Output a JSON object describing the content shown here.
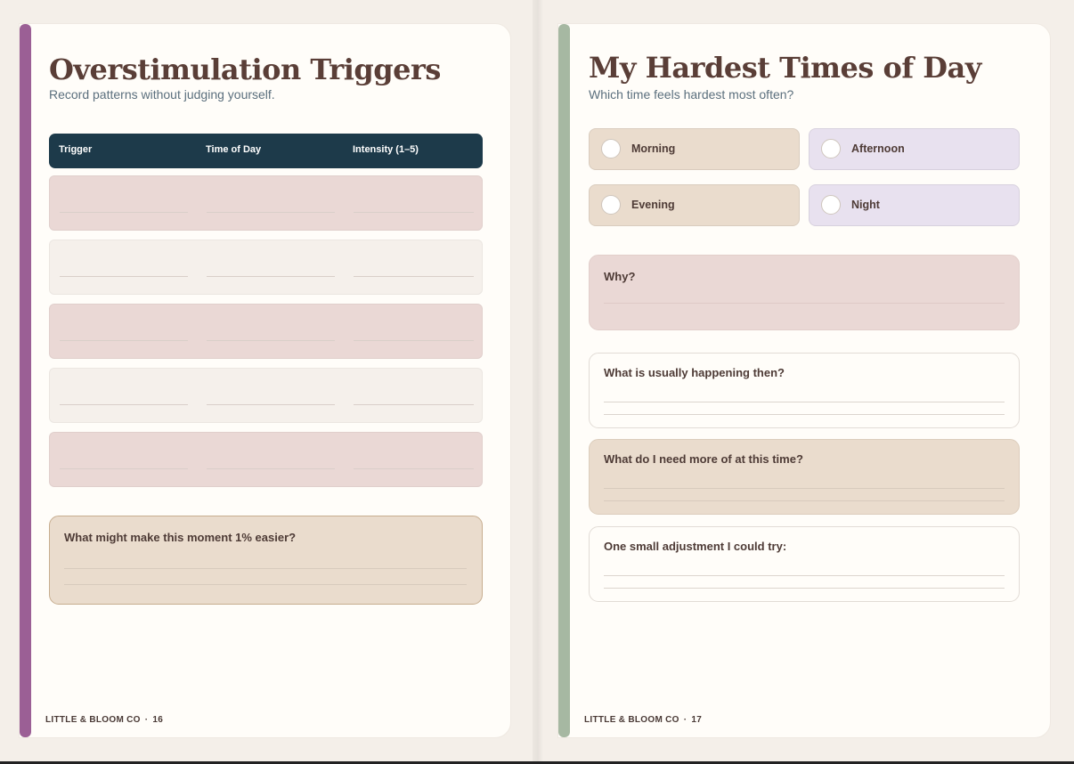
{
  "left_page": {
    "title": "Overstimulation Triggers",
    "subtitle": "Record patterns without judging yourself.",
    "table": {
      "columns": [
        "Trigger",
        "Time of Day",
        "Intensity (1–5)"
      ],
      "rows": 5
    },
    "prompt": "What might make this moment 1% easier?",
    "footer": {
      "brand": "LITTLE & BLOOM CO",
      "separator": "·",
      "page": "16"
    },
    "accent_color": "#9b5f95"
  },
  "right_page": {
    "title": "My Hardest Times of Day",
    "subtitle": "Which time feels hardest most often?",
    "options": [
      "Morning",
      "Afternoon",
      "Evening",
      "Night"
    ],
    "prompts": [
      "Why?",
      "What is usually happening then?",
      "What do I need more of at this time?",
      "One small adjustment I could try:"
    ],
    "footer": {
      "brand": "LITTLE & BLOOM CO",
      "separator": "·",
      "page": "17"
    },
    "accent_color": "#a6b8a2"
  },
  "colors": {
    "header": "#1d3a4a",
    "rose": "#ead8d5",
    "cream": "#f5f0eb",
    "tan": "#eadccd",
    "lavender": "#e8e1ef",
    "title": "#5a3e37"
  }
}
